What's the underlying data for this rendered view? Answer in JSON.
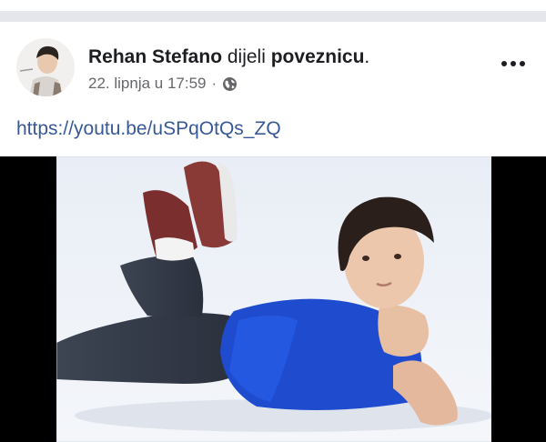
{
  "post": {
    "author_name": "Rehan Stefano",
    "action_text": " dijeli ",
    "action_object": "poveznicu",
    "action_end": ".",
    "timestamp": "22. lipnja u 17:59",
    "separator": "·",
    "privacy_icon": "globe-icon",
    "more_icon": "more-options-icon",
    "link_text": "https://youtu.be/uSPqOtQs_ZQ"
  },
  "media": {
    "icon": "video-thumbnail"
  },
  "colors": {
    "text": "#1c1e21",
    "meta": "#65676b",
    "link": "#385898",
    "divider": "#e4e6eb"
  }
}
